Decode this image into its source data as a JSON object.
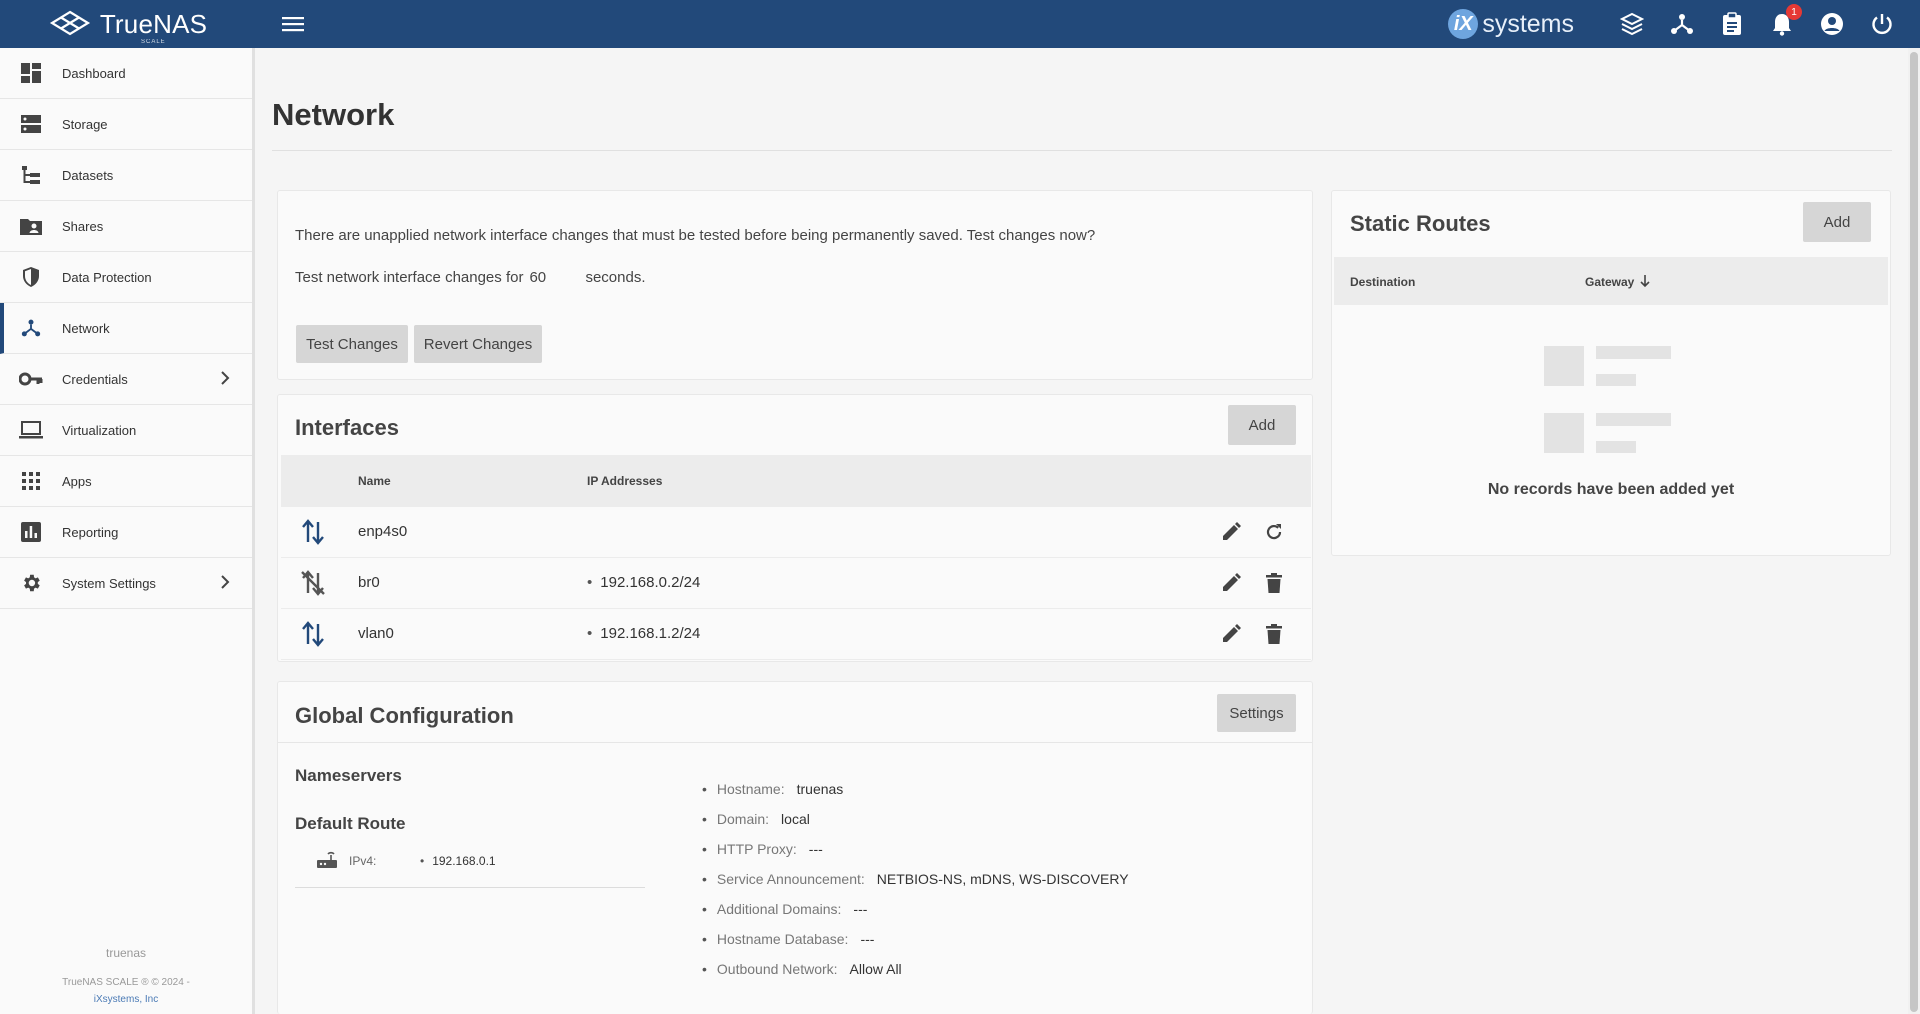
{
  "brand": {
    "name": "TrueNAS",
    "sub": "SCALE"
  },
  "topbar": {
    "vendor_mark": "iX",
    "vendor_text": "systems",
    "notification_count": "1"
  },
  "sidebar": {
    "items": [
      {
        "label": "Dashboard",
        "icon": "dashboard-icon"
      },
      {
        "label": "Storage",
        "icon": "storage-icon"
      },
      {
        "label": "Datasets",
        "icon": "datasets-icon"
      },
      {
        "label": "Shares",
        "icon": "shares-icon"
      },
      {
        "label": "Data Protection",
        "icon": "shield-icon"
      },
      {
        "label": "Network",
        "icon": "network-icon"
      },
      {
        "label": "Credentials",
        "icon": "key-icon"
      },
      {
        "label": "Virtualization",
        "icon": "laptop-icon"
      },
      {
        "label": "Apps",
        "icon": "apps-icon"
      },
      {
        "label": "Reporting",
        "icon": "reporting-icon"
      },
      {
        "label": "System Settings",
        "icon": "gear-icon"
      }
    ],
    "footer_host": "truenas",
    "footer_copy": "TrueNAS SCALE ® © 2024 -",
    "footer_link": "iXsystems, Inc"
  },
  "page": {
    "title": "Network"
  },
  "pending": {
    "message": "There are unapplied network interface changes that must be tested before being permanently saved. Test changes now?",
    "test_prefix": "Test network interface changes for",
    "seconds_value": "60",
    "test_suffix": "seconds.",
    "test_button": "Test Changes",
    "revert_button": "Revert Changes"
  },
  "interfaces": {
    "title": "Interfaces",
    "add_button": "Add",
    "col_name": "Name",
    "col_ip": "IP Addresses",
    "rows": [
      {
        "name": "enp4s0",
        "ip": ""
      },
      {
        "name": "br0",
        "ip": "192.168.0.2/24"
      },
      {
        "name": "vlan0",
        "ip": "192.168.1.2/24"
      }
    ]
  },
  "global": {
    "title": "Global Configuration",
    "settings_button": "Settings",
    "nameservers_title": "Nameservers",
    "default_route_title": "Default Route",
    "ipv4_label": "IPv4:",
    "ipv4_value": "192.168.0.1",
    "hostname_k": "Hostname:",
    "hostname_v": "truenas",
    "domain_k": "Domain:",
    "domain_v": "local",
    "proxy_k": "HTTP Proxy:",
    "proxy_v": "---",
    "service_k": "Service Announcement:",
    "service_v": "NETBIOS-NS, mDNS, WS-DISCOVERY",
    "add_domains_k": "Additional Domains:",
    "add_domains_v": "---",
    "hostdb_k": "Hostname Database:",
    "hostdb_v": "---",
    "outbound_k": "Outbound Network:",
    "outbound_v": "Allow All"
  },
  "static_routes": {
    "title": "Static Routes",
    "add_button": "Add",
    "col_destination": "Destination",
    "col_gateway": "Gateway",
    "empty_text": "No records have been added yet"
  }
}
